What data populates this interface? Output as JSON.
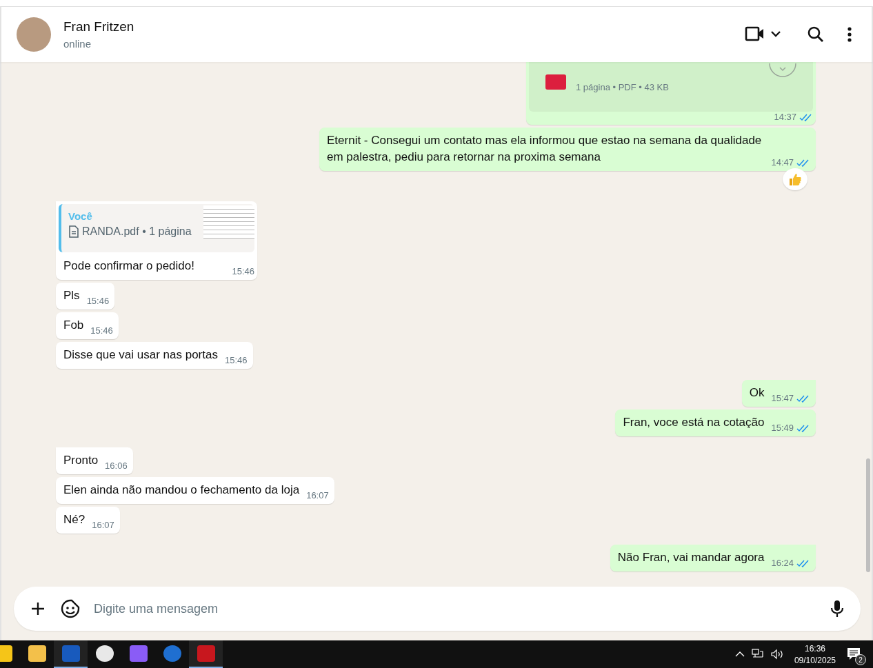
{
  "contact": {
    "name": "Fran Fritzen",
    "status": "online"
  },
  "messages": [
    {
      "kind": "document",
      "outgoing": true,
      "tail": false,
      "meta": "1 página • PDF • 43 KB",
      "time": "14:37",
      "read": true,
      "reaction": false
    },
    {
      "kind": "text",
      "outgoing": true,
      "tail": false,
      "text": "Eternit - Consegui um contato mas ela informou que estao na semana da qualidade em palestra, pediu para retornar na proxima semana",
      "time": "14:47",
      "read": true,
      "reaction": true
    },
    {
      "kind": "reply",
      "outgoing": false,
      "tail": true,
      "quote_author": "Você",
      "quote_file": "RANDA.pdf • 1 página",
      "text": "Pode confirmar o pedido!",
      "time": "15:46",
      "reaction": false
    },
    {
      "kind": "text",
      "outgoing": false,
      "tail": false,
      "text": "Pls",
      "time": "15:46",
      "reaction": false
    },
    {
      "kind": "text",
      "outgoing": false,
      "tail": false,
      "text": "Fob",
      "time": "15:46",
      "reaction": false
    },
    {
      "kind": "text",
      "outgoing": false,
      "tail": false,
      "text": "Disse que vai usar nas portas",
      "time": "15:46",
      "reaction": false
    },
    {
      "kind": "text",
      "outgoing": true,
      "tail": true,
      "text": "Ok",
      "time": "15:47",
      "read": true,
      "reaction": false
    },
    {
      "kind": "text",
      "outgoing": true,
      "tail": false,
      "text": "Fran, voce está na cotação",
      "time": "15:49",
      "read": true,
      "reaction": false
    },
    {
      "kind": "text",
      "outgoing": false,
      "tail": true,
      "text": "Pronto",
      "time": "16:06",
      "reaction": false
    },
    {
      "kind": "text",
      "outgoing": false,
      "tail": false,
      "text": "Elen ainda não mandou o fechamento da loja",
      "time": "16:07",
      "reaction": false
    },
    {
      "kind": "text",
      "outgoing": false,
      "tail": false,
      "text": "Né?",
      "time": "16:07",
      "reaction": false
    },
    {
      "kind": "text",
      "outgoing": true,
      "tail": true,
      "text": "Não Fran, vai mandar agora",
      "time": "16:24",
      "read": true,
      "reaction": false
    }
  ],
  "composer": {
    "placeholder": "Digite uma mensagem"
  },
  "taskbar": {
    "apps": [
      {
        "kind": "sticky",
        "active": false
      },
      {
        "kind": "folder",
        "active": false
      },
      {
        "kind": "word",
        "active": true
      },
      {
        "kind": "snip",
        "active": false
      },
      {
        "kind": "copilot",
        "active": false
      },
      {
        "kind": "mail",
        "active": false
      },
      {
        "kind": "acrobat",
        "active": true
      }
    ],
    "time": "16:36",
    "date": "09/10/2025",
    "notifications": "2"
  }
}
